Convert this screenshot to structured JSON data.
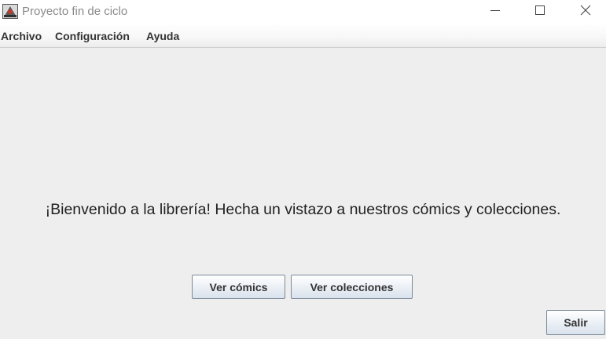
{
  "window": {
    "title": "Proyecto fin de ciclo",
    "app_icon": "java-app-icon",
    "controls": {
      "minimize_icon": "minimize-icon",
      "maximize_icon": "maximize-icon",
      "close_icon": "close-icon"
    }
  },
  "menubar": {
    "items": [
      {
        "label": "Archivo"
      },
      {
        "label": "Configuración"
      },
      {
        "label": "Ayuda"
      }
    ]
  },
  "main": {
    "welcome_text": "¡Bienvenido a la librería! Hecha un vistazo a nuestros cómics y colecciones."
  },
  "buttons": {
    "ver_comics": "Ver cómics",
    "ver_colecciones": "Ver colecciones",
    "salir": "Salir"
  },
  "colors": {
    "background": "#eeeeee",
    "button_border": "#7a8a99",
    "title_text": "#8a8a8a"
  }
}
